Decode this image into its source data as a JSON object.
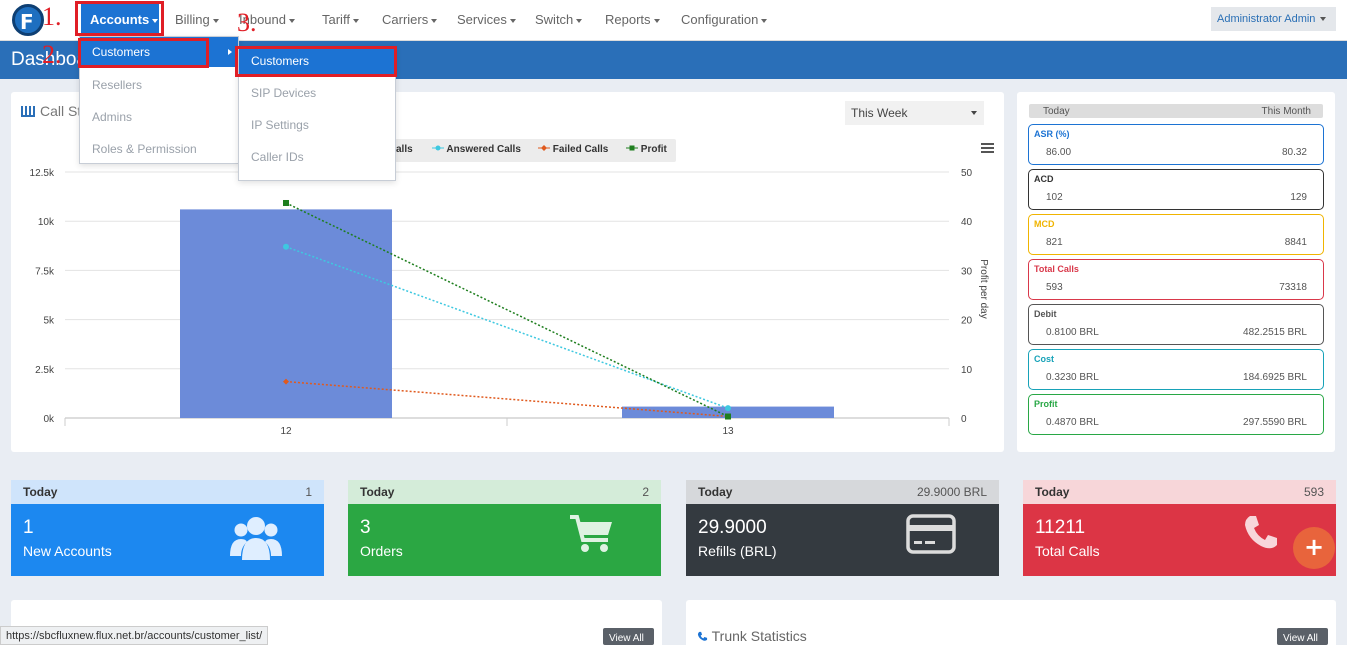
{
  "nav": {
    "logo_letter": "F",
    "items": [
      "Accounts",
      "Billing",
      "Inbound",
      "Tariff",
      "Carriers",
      "Services",
      "Switch",
      "Reports",
      "Configuration"
    ],
    "user": "Administrator Admin"
  },
  "annotations": [
    "1.",
    "2.",
    "3."
  ],
  "accounts_menu": [
    "Customers",
    "Resellers",
    "Admins",
    "Roles & Permission"
  ],
  "customers_submenu": [
    "Customers",
    "SIP Devices",
    "IP Settings",
    "Caller IDs"
  ],
  "page_title": "Dashboard",
  "call_stats": {
    "title": "Call Statistics",
    "period": "This Week",
    "legend_partial": "alls",
    "legend": [
      {
        "label": "Answered Calls",
        "color": "#3ec8e0"
      },
      {
        "label": "Failed Calls",
        "color": "#e05a1e"
      },
      {
        "label": "Profit",
        "color": "#1e7e1e"
      }
    ],
    "y_axis_right_label": "Profit per day"
  },
  "chart_data": {
    "type": "bar",
    "categories": [
      "12",
      "13"
    ],
    "y_ticks_left": [
      "0k",
      "2.5k",
      "5k",
      "7.5k",
      "10k",
      "12.5k"
    ],
    "y_ticks_right": [
      "0",
      "10",
      "20",
      "30",
      "40",
      "50"
    ],
    "ylim": [
      0,
      12500
    ],
    "ylim_right": [
      0,
      50
    ],
    "bar_values": [
      10600,
      580
    ],
    "bar_color": "#6c8bd9",
    "series": [
      {
        "name": "Answered Calls",
        "values": [
          8700,
          500
        ],
        "color": "#3ec8e0"
      },
      {
        "name": "Failed Calls",
        "values": [
          1850,
          80
        ],
        "color": "#e05a1e"
      },
      {
        "name": "Profit",
        "axis": "right",
        "values": [
          43.7,
          0.3
        ],
        "color": "#1e7e1e"
      }
    ]
  },
  "summary": {
    "tab_today": "Today",
    "tab_month": "This Month",
    "boxes": [
      {
        "label": "ASR (%)",
        "today": "86.00",
        "month": "80.32",
        "color": "#1c73d3"
      },
      {
        "label": "ACD",
        "today": "102",
        "month": "129",
        "color": "#333333"
      },
      {
        "label": "MCD",
        "today": "821",
        "month": "8841",
        "color": "#f0b400"
      },
      {
        "label": "Total Calls",
        "today": "593",
        "month": "73318",
        "color": "#d9384a"
      },
      {
        "label": "Debit",
        "today": "0.8100 BRL",
        "month": "482.2515 BRL",
        "color": "#555555"
      },
      {
        "label": "Cost",
        "today": "0.3230 BRL",
        "month": "184.6925 BRL",
        "color": "#17a2b8"
      },
      {
        "label": "Profit",
        "today": "0.4870 BRL",
        "month": "297.5590 BRL",
        "color": "#28a745"
      }
    ]
  },
  "tiles": [
    {
      "head": "Today",
      "head_value": "1",
      "number": "1",
      "text": "New Accounts",
      "icon": "users-icon",
      "color": "#1c88f0",
      "head_bg": "#cfe4fb"
    },
    {
      "head": "Today",
      "head_value": "2",
      "number": "3",
      "text": "Orders",
      "icon": "cart-icon",
      "color": "#2ba743",
      "head_bg": "#d4ecd9"
    },
    {
      "head": "Today",
      "head_value": "29.9000 BRL",
      "number": "29.9000",
      "text": "Refills (BRL)",
      "icon": "credit-card-icon",
      "color": "#343a40",
      "head_bg": "#d6d8db"
    },
    {
      "head": "Today",
      "head_value": "593",
      "number": "11211",
      "text": "Total Calls",
      "icon": "phone-icon",
      "color": "#dc3545",
      "head_bg": "#f7d6d9"
    }
  ],
  "bottom": {
    "trunk_title": "Trunk Statistics",
    "view_all": "View All"
  },
  "status_url": "https://sbcfluxnew.flux.net.br/accounts/customer_list/"
}
